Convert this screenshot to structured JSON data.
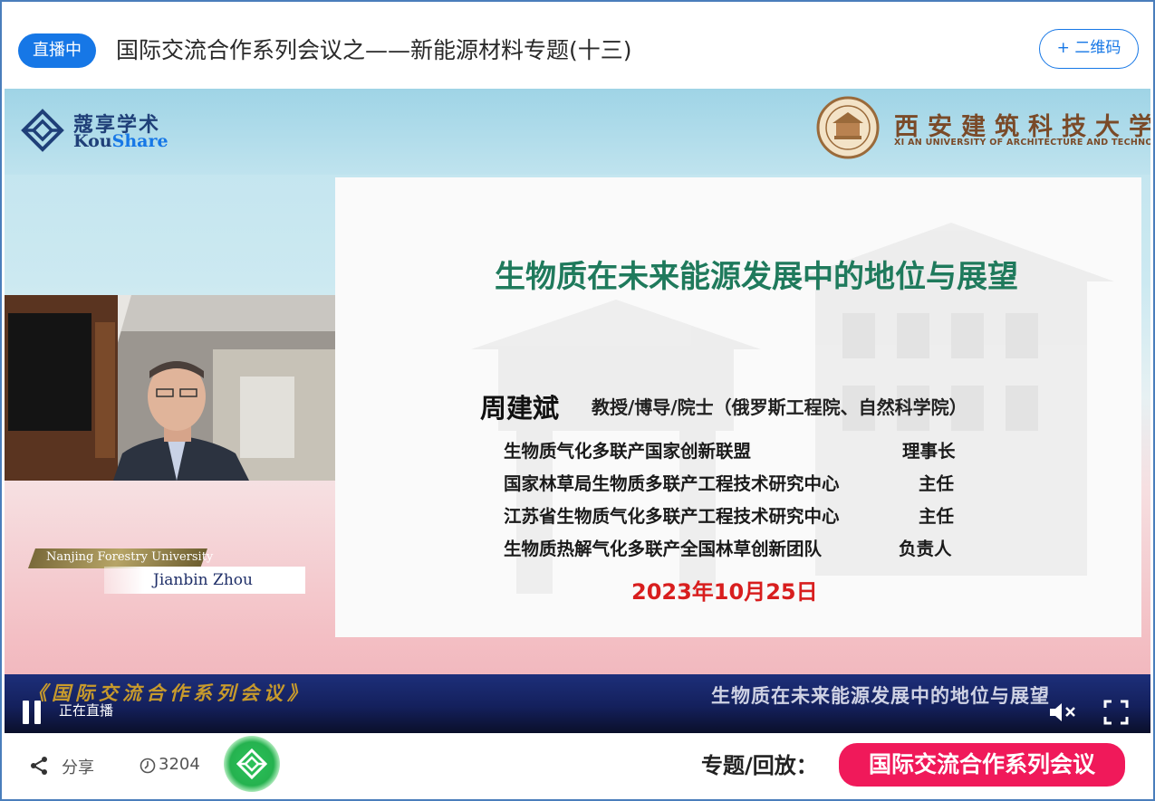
{
  "header": {
    "live_badge": "直播中",
    "title": "国际交流合作系列会议之——新能源材料专题(十三)",
    "qr_button": "+ 二维码"
  },
  "video": {
    "logos": {
      "kou_cn": "蔻享学术",
      "kou_en_a": "Kou",
      "kou_en_b": "Share",
      "univ_cn": "西安建筑科技大学",
      "univ_en": "XI AN UNIVERSITY OF ARCHITECTURE AND TECHNOLOGY"
    },
    "slide": {
      "title": "生物质在未来能源发展中的地位与展望",
      "presenter_name": "周建斌",
      "presenter_titles": "教授/博导/院士（俄罗斯工程院、自然科学院）",
      "affiliations": [
        {
          "org": "生物质气化多联产国家创新联盟",
          "role": "理事长"
        },
        {
          "org": "国家林草局生物质多联产工程技术研究中心",
          "role": "主任"
        },
        {
          "org": "江苏省生物质气化多联产工程技术研究中心",
          "role": "主任"
        },
        {
          "org": "生物质热解气化多联产全国林草创新团队",
          "role": "负责人"
        }
      ],
      "date": "2023年10月25日"
    },
    "name_plate": {
      "affiliation": "Nanjing Forestry University",
      "name": "Jianbin Zhou"
    },
    "band": {
      "series": "《国际交流合作系列会议》",
      "topic": "生物质在未来能源发展中的地位与展望"
    },
    "controls": {
      "live_status": "正在直播"
    }
  },
  "footer": {
    "share_label": "分享",
    "view_count": "3204",
    "topic_label": "专题/回放：",
    "topic_button": "国际交流合作系列会议"
  },
  "colors": {
    "accent_blue": "#1677e6",
    "topic_pink": "#f0195a",
    "slide_title_green": "#1f7a5c",
    "date_red": "#d81e1e"
  },
  "icons": [
    "pause-icon",
    "mute-icon",
    "fullscreen-icon",
    "share-icon",
    "clock-icon",
    "kou-share-float-icon"
  ]
}
